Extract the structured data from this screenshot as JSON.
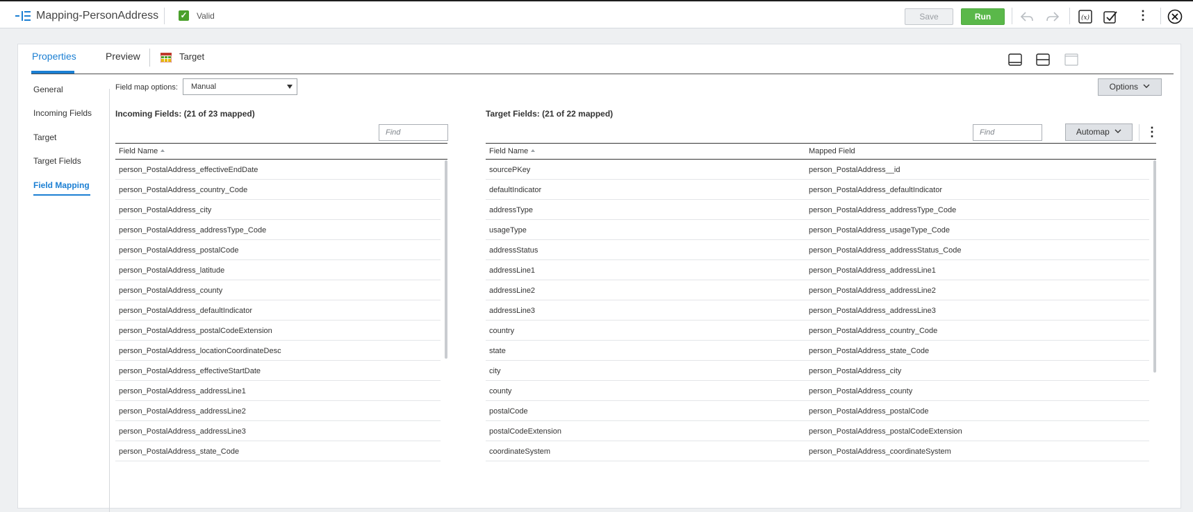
{
  "header": {
    "title": "Mapping-PersonAddress",
    "status": "Valid",
    "save_label": "Save",
    "run_label": "Run"
  },
  "tabs": {
    "properties": "Properties",
    "preview": "Preview",
    "target": "Target"
  },
  "sidenav": {
    "items": [
      "General",
      "Incoming Fields",
      "Target",
      "Target Fields",
      "Field Mapping"
    ],
    "active": "Field Mapping"
  },
  "field_map": {
    "label": "Field map options:",
    "selected": "Manual",
    "options_label": "Options"
  },
  "incoming": {
    "title": "Incoming Fields: (21 of 23 mapped)",
    "find_placeholder": "Find",
    "column": "Field Name",
    "rows": [
      "person_PostalAddress_effectiveEndDate",
      "person_PostalAddress_country_Code",
      "person_PostalAddress_city",
      "person_PostalAddress_addressType_Code",
      "person_PostalAddress_postalCode",
      "person_PostalAddress_latitude",
      "person_PostalAddress_county",
      "person_PostalAddress_defaultIndicator",
      "person_PostalAddress_postalCodeExtension",
      "person_PostalAddress_locationCoordinateDesc",
      "person_PostalAddress_effectiveStartDate",
      "person_PostalAddress_addressLine1",
      "person_PostalAddress_addressLine2",
      "person_PostalAddress_addressLine3",
      "person_PostalAddress_state_Code"
    ]
  },
  "target": {
    "title": "Target Fields: (21 of 22 mapped)",
    "find_placeholder": "Find",
    "automap_label": "Automap",
    "col_field": "Field Name",
    "col_mapped": "Mapped Field",
    "rows": [
      {
        "field": "sourcePKey",
        "mapped": "person_PostalAddress__id"
      },
      {
        "field": "defaultIndicator",
        "mapped": "person_PostalAddress_defaultIndicator"
      },
      {
        "field": "addressType",
        "mapped": "person_PostalAddress_addressType_Code"
      },
      {
        "field": "usageType",
        "mapped": "person_PostalAddress_usageType_Code"
      },
      {
        "field": "addressStatus",
        "mapped": "person_PostalAddress_addressStatus_Code"
      },
      {
        "field": "addressLine1",
        "mapped": "person_PostalAddress_addressLine1"
      },
      {
        "field": "addressLine2",
        "mapped": "person_PostalAddress_addressLine2"
      },
      {
        "field": "addressLine3",
        "mapped": "person_PostalAddress_addressLine3"
      },
      {
        "field": "country",
        "mapped": "person_PostalAddress_country_Code"
      },
      {
        "field": "state",
        "mapped": "person_PostalAddress_state_Code"
      },
      {
        "field": "city",
        "mapped": "person_PostalAddress_city"
      },
      {
        "field": "county",
        "mapped": "person_PostalAddress_county"
      },
      {
        "field": "postalCode",
        "mapped": "person_PostalAddress_postalCode"
      },
      {
        "field": "postalCodeExtension",
        "mapped": "person_PostalAddress_postalCodeExtension"
      },
      {
        "field": "coordinateSystem",
        "mapped": "person_PostalAddress_coordinateSystem"
      }
    ]
  },
  "colors": {
    "accent": "#1b7fd3",
    "run": "#5ab84a",
    "valid": "#4aa02c"
  }
}
